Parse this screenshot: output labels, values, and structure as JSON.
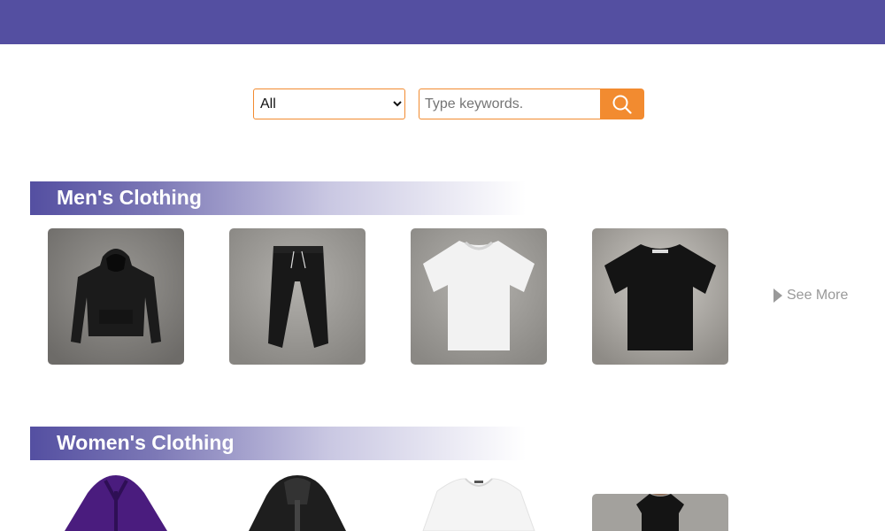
{
  "search": {
    "category_selected": "All",
    "placeholder": "Type keywords."
  },
  "sections": [
    {
      "title": "Men's Clothing",
      "see_more": "See More"
    },
    {
      "title": "Women's Clothing"
    }
  ],
  "colors": {
    "brand": "#544fa1",
    "accent": "#f28b30"
  }
}
